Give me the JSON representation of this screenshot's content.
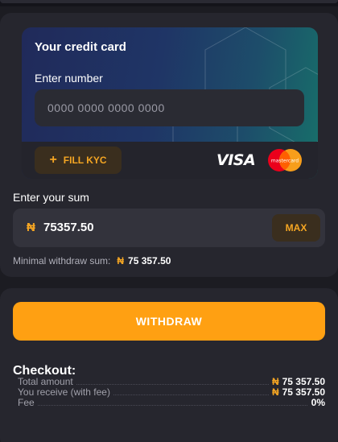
{
  "card": {
    "title": "Your credit card",
    "number_label": "Enter number",
    "number_placeholder": "0000 0000 0000 0000",
    "kyc_label": "FILL KYC",
    "kyc_icon": "+",
    "visa_label": "VISA",
    "mastercard_label": "mastercard"
  },
  "sum": {
    "label": "Enter your sum",
    "currency": "₦",
    "value": "75357.50",
    "max_label": "MAX",
    "min_label": "Minimal withdraw sum:",
    "min_currency": "₦",
    "min_value": "75 357.50"
  },
  "withdraw": {
    "label": "WITHDRAW"
  },
  "checkout": {
    "title": "Checkout:",
    "rows": [
      {
        "label": "Total amount",
        "currency": "₦",
        "value": "75 357.50"
      },
      {
        "label": "You receive (with fee)",
        "currency": "₦",
        "value": "75 357.50"
      },
      {
        "label": "Fee",
        "currency": "",
        "value": "0%"
      }
    ]
  },
  "colors": {
    "accent": "#ffa012",
    "accent_text": "#f5a623",
    "background": "#1c1c22",
    "panel": "#26262e"
  }
}
